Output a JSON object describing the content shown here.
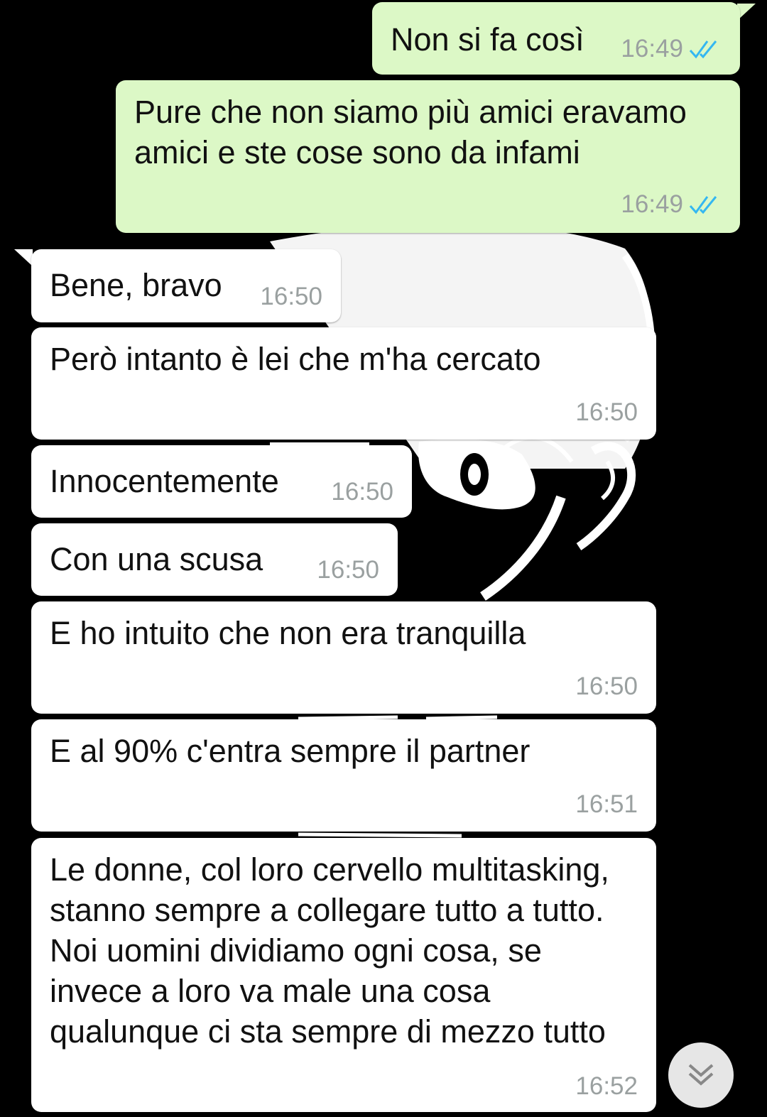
{
  "messages": [
    {
      "direction": "outgoing",
      "text": "Non si fa così",
      "time": "16:49",
      "status_icon": "double-check-read-icon"
    },
    {
      "direction": "outgoing",
      "text": "Pure che non siamo più amici eravamo amici e ste cose sono da infami",
      "time": "16:49",
      "status_icon": "double-check-read-icon"
    },
    {
      "direction": "incoming",
      "text": "Bene, bravo",
      "time": "16:50"
    },
    {
      "direction": "incoming",
      "text": "Però intanto è lei che m'ha cercato",
      "time": "16:50"
    },
    {
      "direction": "incoming",
      "text": "Innocentemente",
      "time": "16:50"
    },
    {
      "direction": "incoming",
      "text": "Con una scusa",
      "time": "16:50"
    },
    {
      "direction": "incoming",
      "text": "E ho intuito che non era tranquilla",
      "time": "16:50"
    },
    {
      "direction": "incoming",
      "text": "E al 90% c'entra sempre il partner",
      "time": "16:51"
    },
    {
      "direction": "incoming",
      "text": "Le donne, col loro cervello multitasking, stanno sempre a collegare tutto a tutto. Noi uomini dividiamo ogni cosa, se invece a loro va male una cosa qualunque ci sta sempre di mezzo tutto",
      "time": "16:52"
    }
  ],
  "scroll_button": {
    "icon": "double-chevron-down-icon"
  },
  "colors": {
    "outgoing_bubble": "#dcf8c6",
    "incoming_bubble": "#ffffff",
    "read_ticks": "#34b7f1",
    "timestamp": "#9aa0a0",
    "wallpaper": "#000000"
  }
}
